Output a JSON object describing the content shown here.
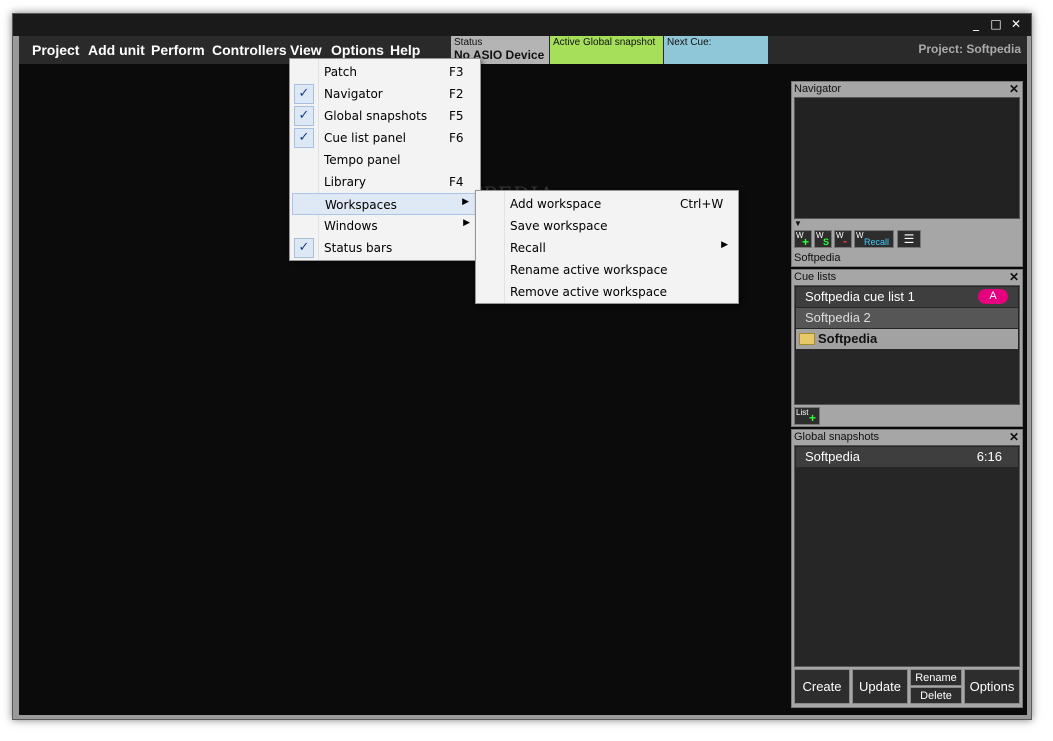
{
  "window": {
    "controls": [
      "_",
      "□",
      "✕"
    ]
  },
  "menubar": {
    "items": [
      "Project",
      "Add unit",
      "Perform",
      "Controllers",
      "View",
      "Options",
      "Help"
    ],
    "status": {
      "label": "Status",
      "value": "No ASIO Device"
    },
    "active_snapshot": {
      "label": "Active Global snapshot",
      "color": "#a6e05a"
    },
    "next_cue": {
      "label": "Next Cue:",
      "color": "#8fc6d8"
    },
    "project": "Project: Softpedia"
  },
  "view_menu": {
    "items": [
      {
        "label": "Patch",
        "shortcut": "F3",
        "checked": false
      },
      {
        "label": "Navigator",
        "shortcut": "F2",
        "checked": true
      },
      {
        "label": "Global snapshots",
        "shortcut": "F5",
        "checked": true
      },
      {
        "label": "Cue list panel",
        "shortcut": "F6",
        "checked": true
      },
      {
        "label": "Tempo panel",
        "shortcut": "",
        "checked": false
      },
      {
        "label": "Library",
        "shortcut": "F4",
        "checked": false
      },
      {
        "label": "Workspaces",
        "shortcut": "",
        "checked": false,
        "submenu": true
      },
      {
        "label": "Windows",
        "shortcut": "",
        "checked": false,
        "submenu": true
      },
      {
        "label": "Status bars",
        "shortcut": "",
        "checked": true
      }
    ]
  },
  "workspaces_menu": {
    "items": [
      {
        "label": "Add workspace",
        "shortcut": "Ctrl+W"
      },
      {
        "label": "Save workspace",
        "shortcut": ""
      },
      {
        "label": "Recall",
        "shortcut": "",
        "submenu": true
      },
      {
        "label": "Rename active workspace",
        "shortcut": ""
      },
      {
        "label": "Remove active workspace",
        "shortcut": ""
      }
    ]
  },
  "navigator": {
    "title": "Navigator",
    "close": "✕",
    "buttons": [
      "W+",
      "WS",
      "W-",
      "Recall"
    ],
    "recall_label": "Recall",
    "name": "Softpedia"
  },
  "cue_lists": {
    "title": "Cue lists",
    "close": "✕",
    "rows": [
      {
        "label": "Softpedia cue list 1",
        "badge": "A"
      },
      {
        "label": "Softpedia 2"
      },
      {
        "label": "Softpedia",
        "folder": true
      }
    ],
    "add_label": "List"
  },
  "global_snapshots": {
    "title": "Global snapshots",
    "close": "✕",
    "rows": [
      {
        "label": "Softpedia",
        "time": "6:16"
      }
    ],
    "buttons": {
      "create": "Create",
      "update": "Update",
      "rename": "Rename",
      "delete": "Delete",
      "options": "Options"
    }
  },
  "watermark": "SOFTPEDIA"
}
